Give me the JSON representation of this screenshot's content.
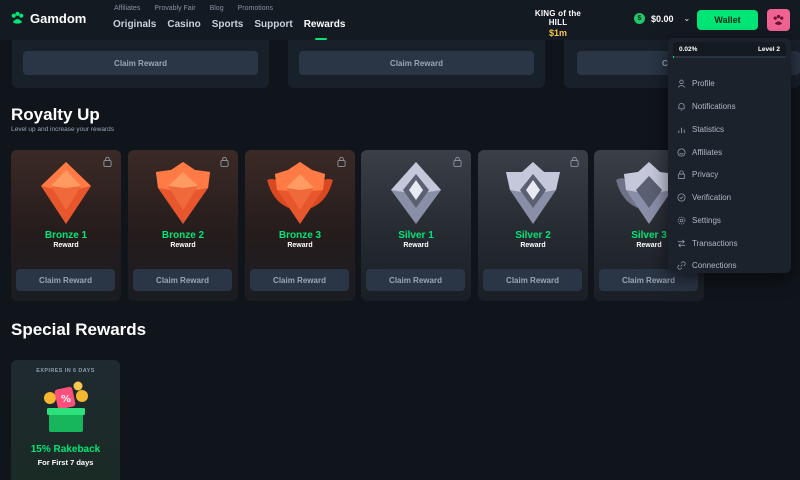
{
  "header": {
    "logo_text": "Gamdom",
    "subnav": [
      "Affiliates",
      "Provably Fair",
      "Blog",
      "Promotions"
    ],
    "mainnav": [
      "Originals",
      "Casino",
      "Sports",
      "Support",
      "Rewards"
    ],
    "koth_title": "KING of the HILL",
    "koth_prize": "$1m",
    "balance": "$0.00",
    "wallet_label": "Wallet",
    "colors": {
      "accent": "#00e676",
      "avatar": "#f06292"
    }
  },
  "top_claims": [
    "Claim Reward",
    "Claim Reward",
    "Claim Reward"
  ],
  "royalty": {
    "title": "Royalty Up",
    "subtitle": "Level up and increase your rewards",
    "cards": [
      {
        "name": "Bronze 1",
        "sub": "Reward",
        "claim": "Claim Reward",
        "tier": "bronze"
      },
      {
        "name": "Bronze 2",
        "sub": "Reward",
        "claim": "Claim Reward",
        "tier": "bronze"
      },
      {
        "name": "Bronze 3",
        "sub": "Reward",
        "claim": "Claim Reward",
        "tier": "bronze"
      },
      {
        "name": "Silver 1",
        "sub": "Reward",
        "claim": "Claim Reward",
        "tier": "silver"
      },
      {
        "name": "Silver 2",
        "sub": "Reward",
        "claim": "Claim Reward",
        "tier": "silver"
      },
      {
        "name": "Silver 3",
        "sub": "Reward",
        "claim": "Claim Reward",
        "tier": "silver"
      }
    ]
  },
  "special": {
    "title": "Special Rewards",
    "card": {
      "expires": "EXPIRES IN 6 DAYS",
      "name": "15% Rakeback",
      "sub": "For First 7 days"
    }
  },
  "dropdown": {
    "progress_label": "0.02%",
    "progress_value": 0.02,
    "level_label": "Level 2",
    "items": [
      {
        "label": "Profile",
        "icon": "user-icon"
      },
      {
        "label": "Notifications",
        "icon": "bell-icon"
      },
      {
        "label": "Statistics",
        "icon": "stats-icon"
      },
      {
        "label": "Affiliates",
        "icon": "smile-icon"
      },
      {
        "label": "Privacy",
        "icon": "lock-icon"
      },
      {
        "label": "Verification",
        "icon": "check-circle-icon"
      },
      {
        "label": "Settings",
        "icon": "gear-icon"
      },
      {
        "label": "Transactions",
        "icon": "transfer-icon"
      },
      {
        "label": "Connections",
        "icon": "link-icon"
      }
    ]
  }
}
